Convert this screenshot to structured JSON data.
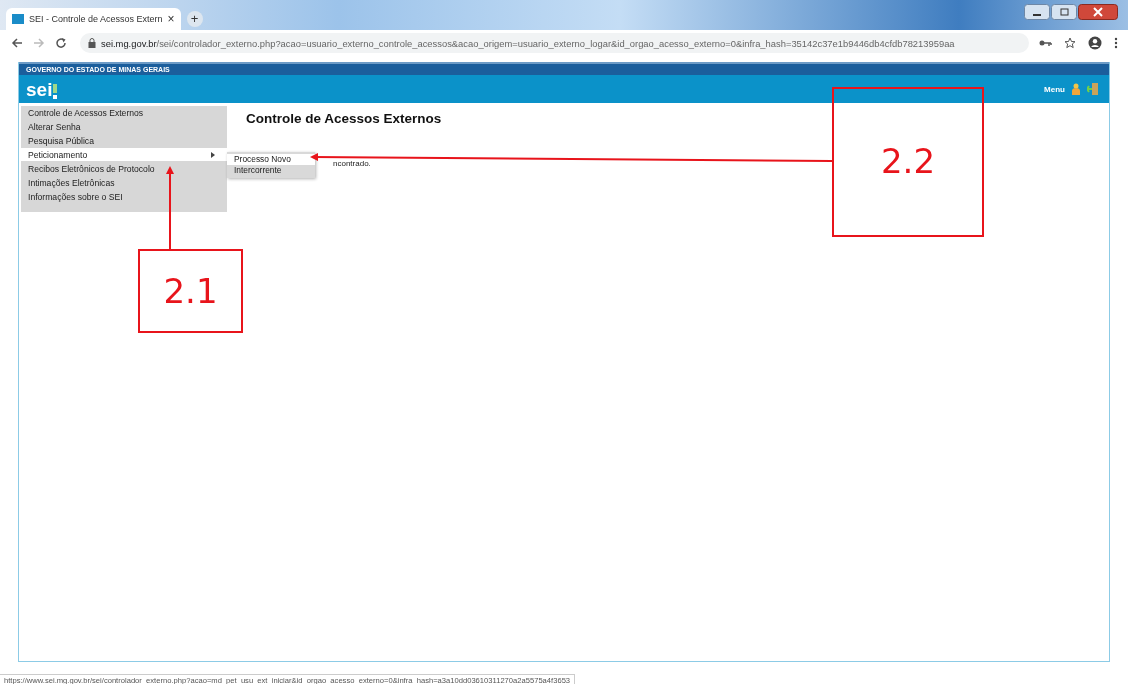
{
  "browser": {
    "tab_title": "SEI - Controle de Acessos Extern",
    "tab_close": "×",
    "new_tab": "+",
    "url_host": "sei.mg.gov.br",
    "url_path": "/sei/controlador_externo.php?acao=usuario_externo_controle_acessos&acao_origem=usuario_externo_logar&id_orgao_acesso_externo=0&infra_hash=35142c37e1b9446db4cfdb78213959aa",
    "status_url": "https://www.sei.mg.gov.br/sei/controlador_externo.php?acao=md_pet_usu_ext_iniciar&id_orgao_acesso_externo=0&infra_hash=a3a10dd03610311270a2a5575a4f3653"
  },
  "header": {
    "government": "GOVERNO DO ESTADO DE MINAS GERAIS",
    "logo": "sei",
    "menu": "Menu"
  },
  "sidebar": {
    "items": [
      {
        "label": "Controle de Acessos Externos",
        "selected": false,
        "has_submenu": false
      },
      {
        "label": "Alterar Senha",
        "selected": false,
        "has_submenu": false
      },
      {
        "label": "Pesquisa Pública",
        "selected": false,
        "has_submenu": false
      },
      {
        "label": "Peticionamento",
        "selected": true,
        "has_submenu": true
      },
      {
        "label": "Recibos Eletrônicos de Protocolo",
        "selected": false,
        "has_submenu": false
      },
      {
        "label": "Intimações Eletrônicas",
        "selected": false,
        "has_submenu": false
      },
      {
        "label": "Informações sobre o SEI",
        "selected": false,
        "has_submenu": false
      }
    ]
  },
  "submenu": {
    "items": [
      {
        "label": "Processo Novo",
        "selected": true
      },
      {
        "label": "Intercorrente",
        "selected": false
      }
    ]
  },
  "content": {
    "title": "Controle de Acessos Externos",
    "message": "ncontrado."
  },
  "annotations": [
    {
      "label": "2.1"
    },
    {
      "label": "2.2"
    }
  ]
}
